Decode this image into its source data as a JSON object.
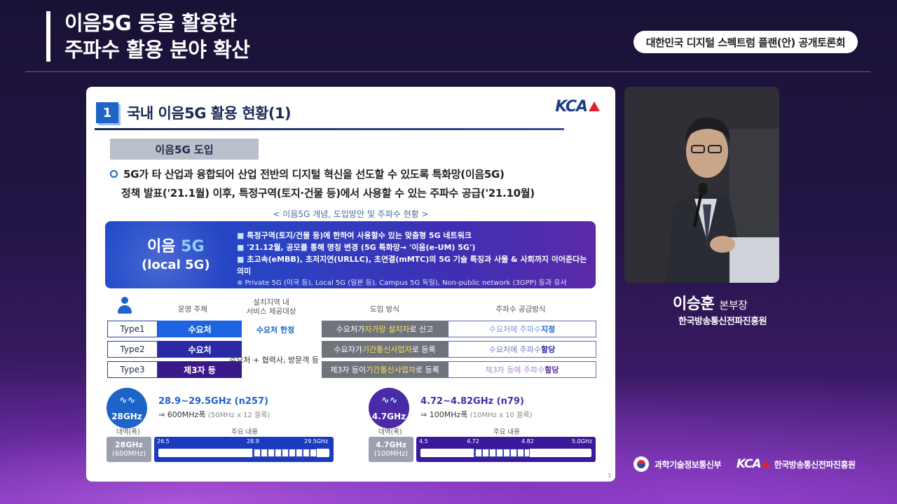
{
  "header": {
    "title_line1": "이음5G 등을 활용한",
    "title_line2": "주파수 활용 분야 확산",
    "event": "대한민국 디지털 스펙트럼 플랜(안) 공개토론회"
  },
  "slide": {
    "number": "1",
    "title": "국내 이음5G 활용 현황(1)",
    "logo": "KCA",
    "section_tab": "이음5G 도입",
    "bullet_line1": "5G가 타 산업과 융합되어 산업 전반의 디지털 혁신을 선도할 수 있도록 특화망(이음5G)",
    "bullet_line2": "정책 발표('21.1월) 이후, 특정구역(토지·건물 등)에서 사용할 수 있는 주파수 공급('21.10월)",
    "caption": "< 이음5G 개념, 도입방안 및 주파수 현황 >",
    "banner": {
      "logo_line1_a": "이음",
      "logo_line1_b": "5G",
      "logo_line2": "(local 5G)",
      "items": [
        "특정구역(토지/건물 등)에 한하여 사용할수 있는 맞춤형 5G 네트워크",
        "'21.12월, 공모를 통해 명칭 변경 (5G 특화망→ '이음(e-UM) 5G')",
        "초고속(eMBB), 초저지연(URLLC), 초연결(mMTC)의 5G 기술 특징과 사물 & 사회까지 이어준다는 의미"
      ],
      "note": "※ Private 5G (미국 등), Local 5G (일본 등), Campus 5G 독일), Non-public network (3GPP) 등과 유사"
    },
    "table": {
      "headers": {
        "operator": "운영 주체",
        "region": "설치지역 내\n서비스 제공대상",
        "method": "도입 방식",
        "supply": "주파수 공급방식"
      },
      "rows": [
        {
          "type": "Type1",
          "operator": "수요처",
          "method_a": "수요처가 ",
          "method_hl": "자가망 설치자",
          "method_b": "로 신고",
          "supply_a": "수요처에 주파수 ",
          "supply_b": "지정"
        },
        {
          "type": "Type2",
          "operator": "수요처",
          "method_a": "수요자가 ",
          "method_hl": "기간통신사업자",
          "method_b": "로 등록",
          "supply_a": "수요처에 주파수 ",
          "supply_b": "할당"
        },
        {
          "type": "Type3",
          "operator": "제3자 등",
          "method_a": "제3자 등이 ",
          "method_hl": "기간통신사업자",
          "method_b": "로 등록",
          "supply_a": "제3자 등에 주파수 ",
          "supply_b": "할당"
        }
      ],
      "region_1": "수요처 한정",
      "region_23": "수요처 + 협력사, 방문객 등"
    },
    "bands": [
      {
        "circle": "28GHz",
        "title": "28.9~29.5GHz (n257)",
        "sub": "⇒ 600MHz폭",
        "sub_light": "(50MHz x 12 블록)",
        "col1": "대역(폭)",
        "col2": "주요 내용",
        "box_main": "28GHz",
        "box_sub": "(600MHz)",
        "ticks": [
          "26.5",
          "28.9",
          "29.5GHz"
        ]
      },
      {
        "circle": "4.7GHz",
        "title": "4.72~4.82GHz (n79)",
        "sub": "⇒ 100MHz폭",
        "sub_light": "(10MHz x 10 블록)",
        "col1": "대역(폭)",
        "col2": "주요 내용",
        "box_main": "4.7GHz",
        "box_sub": "(100MHz)",
        "ticks": [
          "4.5",
          "4.72",
          "4.82",
          "5.0GHz"
        ]
      }
    ],
    "page": "3"
  },
  "speaker": {
    "name": "이승훈",
    "role": "본부장",
    "org": "한국방송통신전파진흥원"
  },
  "footer": {
    "ministry": "과학기술정보통신부",
    "kca": "KCA",
    "org": "한국방송통신전파진흥원"
  },
  "colors": {
    "accent_blue": "#1e64c8",
    "navy": "#1b2b55",
    "type1": "#1e64e0",
    "type2": "#2a2aa8",
    "type3": "#3a1a8a",
    "highlight": "#ffe25a"
  }
}
